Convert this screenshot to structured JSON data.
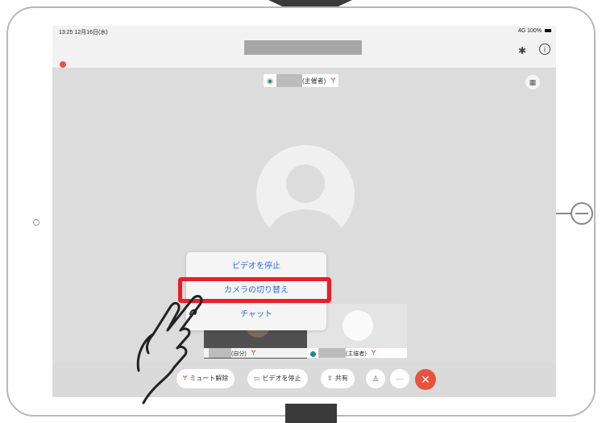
{
  "status_bar": {
    "time": "13:25  12月16日(水)",
    "battery": "4G 100%"
  },
  "host_tile": {
    "role": "(主催者)"
  },
  "popup_menu": {
    "items": [
      "ビデオを停止",
      "カメラの切り替え",
      "チャット"
    ],
    "highlighted_item": "カメラの切り替え"
  },
  "thumbnails": {
    "self_label": "(自分)",
    "host_label": "(主催者)"
  },
  "controls": {
    "unmute": "ミュート解除",
    "stop_video": "ビデオを停止",
    "share": "共有",
    "more": "···"
  },
  "colors": {
    "accent_red": "#ee1c25",
    "link_blue": "#2a6fd8",
    "leave_red": "#e8533e"
  }
}
